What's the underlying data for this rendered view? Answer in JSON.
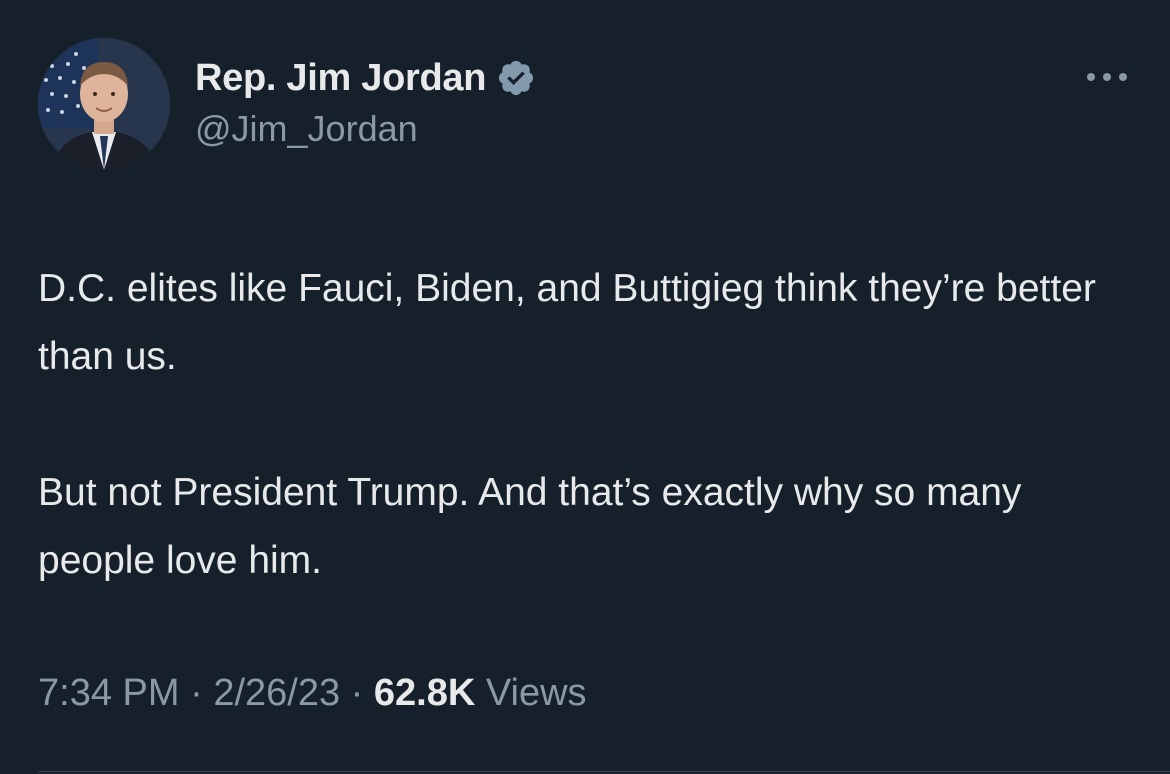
{
  "author": {
    "display_name": "Rep. Jim Jordan",
    "handle": "@Jim_Jordan",
    "verified_icon": "verified-badge-icon",
    "avatar_icon": "profile-photo"
  },
  "tweet": {
    "paragraphs": [
      "D.C. elites like Fauci, Biden, and Buttigieg think they’re better than us.",
      "But not President Trump. And that’s exactly why so many people love him."
    ]
  },
  "meta": {
    "time": "7:34 PM",
    "separator": " · ",
    "date": "2/26/23",
    "views_count": "62.8K",
    "views_label": " Views"
  },
  "icons": {
    "more": "more-options-icon"
  },
  "colors": {
    "background": "#15202b",
    "text_primary": "#e7e9ea",
    "text_secondary": "#8b98a5",
    "verified_badge": "#829aab"
  }
}
